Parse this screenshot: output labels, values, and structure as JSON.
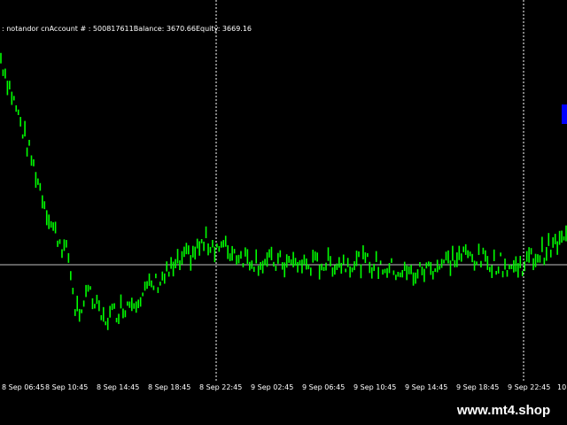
{
  "account_info": {
    "broker": ": notandor cn",
    "account_label": "Account # ",
    "account_number": ": 500817611",
    "balance_label": "Balance",
    "balance_value": ": 3670.66",
    "equity_label": "Equity",
    "equity_value": ": 3669.16"
  },
  "time_axis": {
    "labels": [
      "8 Sep 06:45",
      "8 Sep 10:45",
      "8 Sep 14:45",
      "8 Sep 18:45",
      "8 Sep 22:45",
      "9 Sep 02:45",
      "9 Sep 06:45",
      "9 Sep 10:45",
      "9 Sep 14:45",
      "9 Sep 18:45",
      "9 Sep 22:45",
      "10"
    ]
  },
  "watermark": {
    "text": "www.mt4.shop"
  },
  "colors": {
    "background": "#000000",
    "candle": "#00ff00",
    "grid": "#ffffff",
    "marker": "#0000ff"
  },
  "chart_data": {
    "type": "line",
    "title": "",
    "xlabel": "",
    "ylabel": "",
    "x": [
      "8 Sep 06:45",
      "8 Sep 10:45",
      "8 Sep 14:45",
      "8 Sep 18:45",
      "8 Sep 22:45",
      "9 Sep 02:45",
      "9 Sep 06:45",
      "9 Sep 10:45",
      "9 Sep 14:45",
      "9 Sep 18:45",
      "9 Sep 22:45",
      "10"
    ],
    "series": [
      {
        "values": [
          0.94,
          0.42,
          0.13,
          0.24,
          0.37,
          0.31,
          0.3,
          0.31,
          0.27,
          0.33,
          0.29,
          0.38
        ]
      }
    ],
    "grid": true,
    "current_level": 0.3
  }
}
